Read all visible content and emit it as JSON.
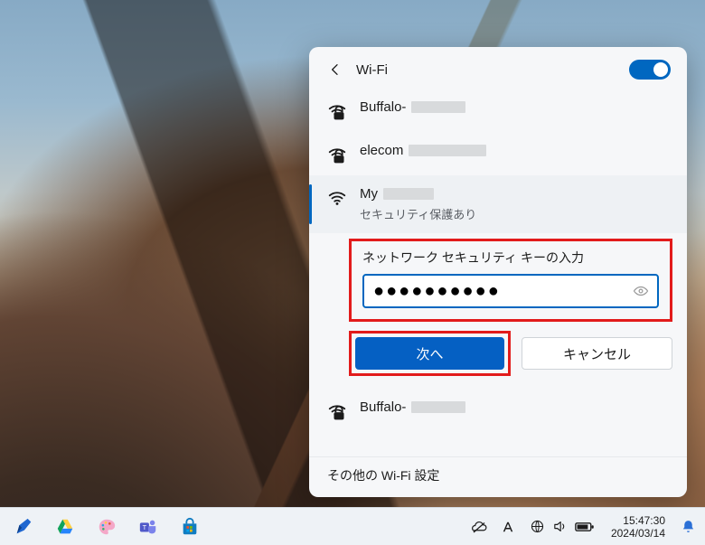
{
  "panel": {
    "title": "Wi-Fi",
    "toggle_on": true,
    "networks": [
      {
        "ssid": "Buffalo-",
        "secured": true,
        "redacted": true
      },
      {
        "ssid": "elecom",
        "secured": true,
        "redacted": true
      },
      {
        "ssid": "My",
        "secured": true,
        "redacted": true,
        "selected": true,
        "subtext": "セキュリティ保護あり"
      },
      {
        "ssid": "Buffalo-",
        "secured": true,
        "redacted": true
      }
    ],
    "connect": {
      "prompt": "ネットワーク セキュリティ キーの入力",
      "password_mask": "●●●●●●●●●●",
      "next_label": "次へ",
      "cancel_label": "キャンセル"
    },
    "other_settings": "その他の Wi-Fi 設定"
  },
  "taskbar": {
    "time": "15:47:30",
    "date": "2024/03/14"
  }
}
